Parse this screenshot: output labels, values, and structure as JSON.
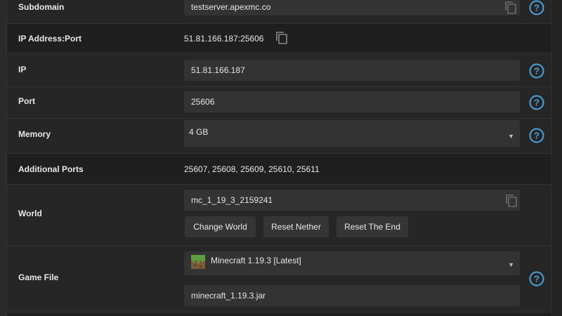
{
  "rows": {
    "subdomain": {
      "label": "Subdomain",
      "value": "testserver.apexmc.co"
    },
    "ip_port": {
      "label": "IP Address:Port",
      "value": "51.81.166.187:25606"
    },
    "ip": {
      "label": "IP",
      "value": "51.81.166.187"
    },
    "port": {
      "label": "Port",
      "value": "25606"
    },
    "memory": {
      "label": "Memory",
      "value": "4 GB"
    },
    "additional_ports": {
      "label": "Additional Ports",
      "value": "25607, 25608, 25609, 25610, 25611"
    },
    "world": {
      "label": "World",
      "value": "mc_1_19_3_2159241",
      "buttons": {
        "change": "Change World",
        "reset_nether": "Reset Nether",
        "reset_end": "Reset The End"
      }
    },
    "game_file": {
      "label": "Game File",
      "version": "Minecraft 1.19.3 [Latest]",
      "jar": "minecraft_1.19.3.jar"
    }
  },
  "icons": {
    "copy": "copy-icon",
    "help": "help-icon",
    "chevron": "chevron-down-icon",
    "grass": "grass-block-icon"
  },
  "colors": {
    "help": "#4aa3df",
    "background": "#1e1e1e",
    "field": "#333333"
  }
}
